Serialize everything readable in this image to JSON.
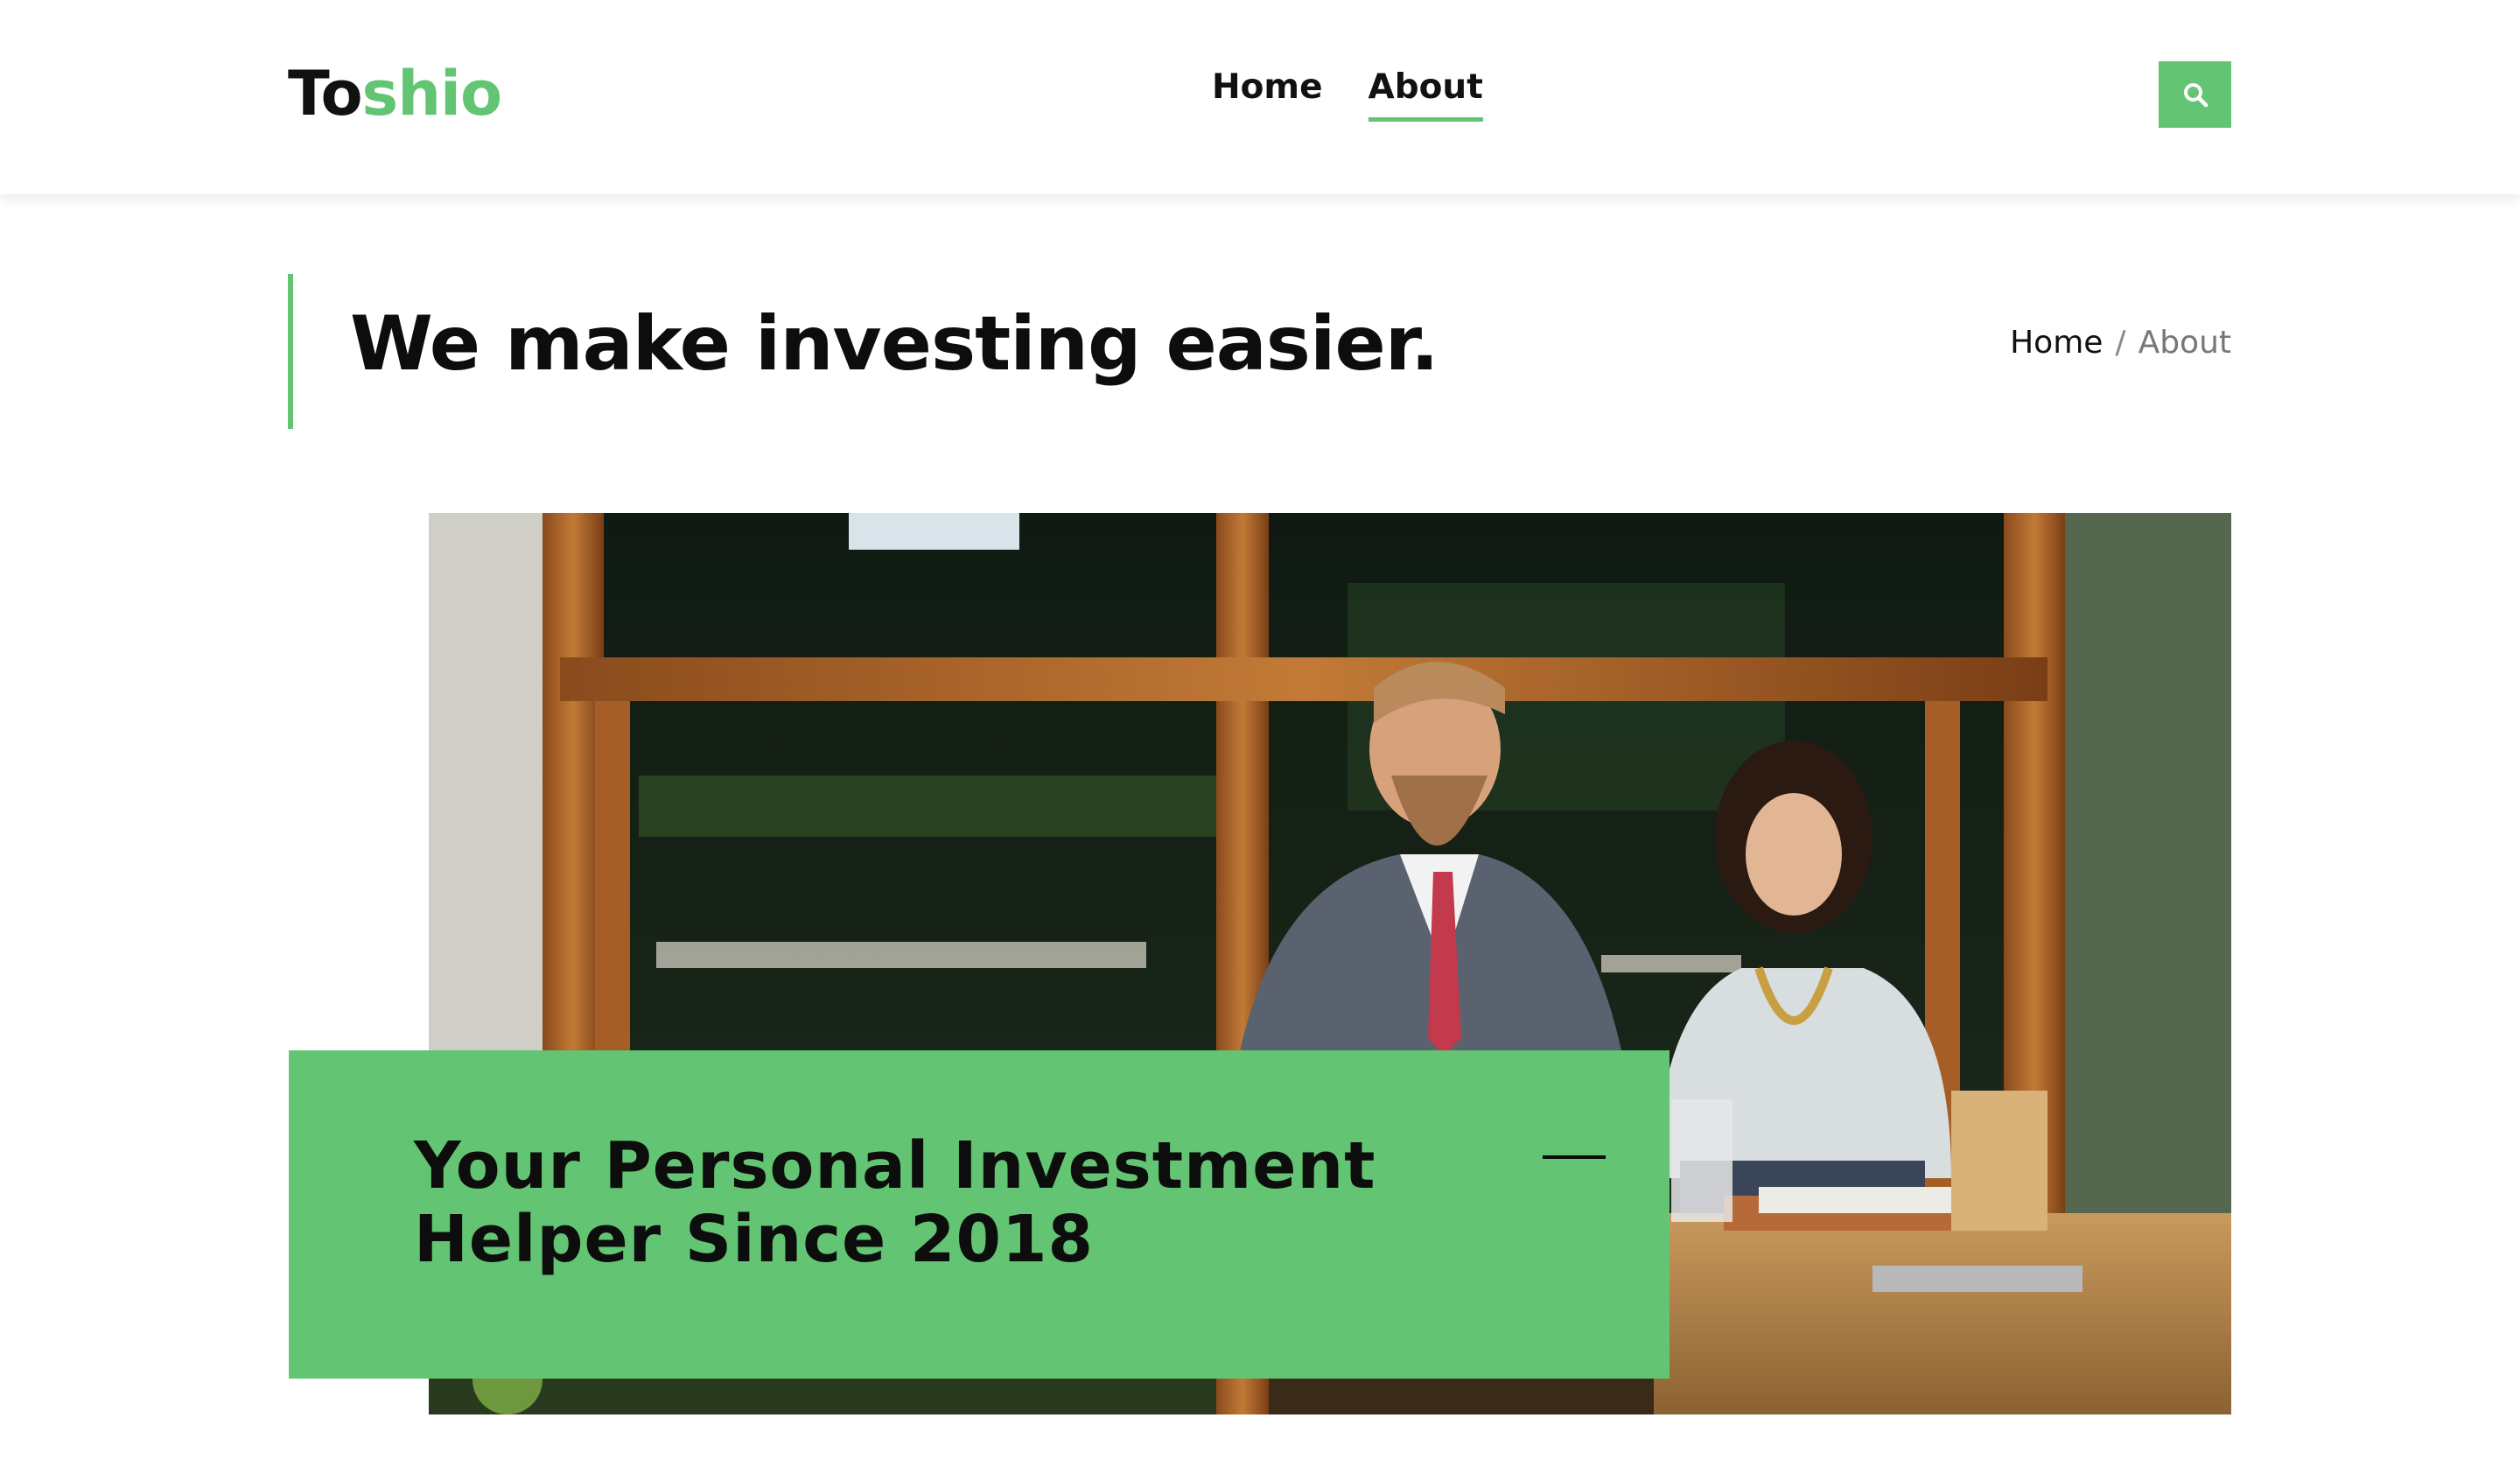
{
  "brand": {
    "logo_part_a": "To",
    "logo_part_b": "shio",
    "accent_color": "#63c573"
  },
  "nav": {
    "items": [
      {
        "label": "Home",
        "active": false
      },
      {
        "label": "About",
        "active": true
      }
    ],
    "search_icon": "search-icon"
  },
  "page": {
    "title": "We make investing easier."
  },
  "breadcrumb": {
    "home": "Home",
    "separator": "/",
    "current": "About"
  },
  "hero": {
    "caption": "Your Personal Investment Helper Since 2018"
  }
}
